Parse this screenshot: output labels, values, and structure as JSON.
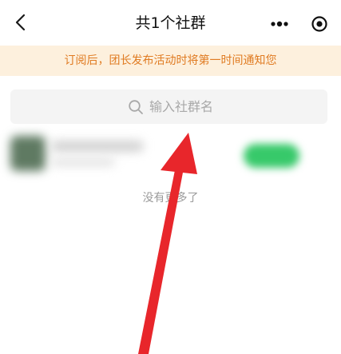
{
  "nav": {
    "title": "共1个社群",
    "back_icon": "chevron-left-icon",
    "more_icon": "more-dots-icon",
    "close_icon": "target-circle-icon"
  },
  "notice": {
    "text": "订阅后，团长发布活动时将第一时间通知您"
  },
  "search": {
    "placeholder": "输入社群名",
    "value": "",
    "icon": "search-icon"
  },
  "group_list": {
    "items": [
      {
        "avatar": "blurred",
        "name": "",
        "action_color": "#37c96a"
      }
    ],
    "end_text": "没有更多了"
  },
  "annotation": {
    "type": "red-arrow",
    "color": "#e8262b",
    "points_to": "search-box"
  }
}
